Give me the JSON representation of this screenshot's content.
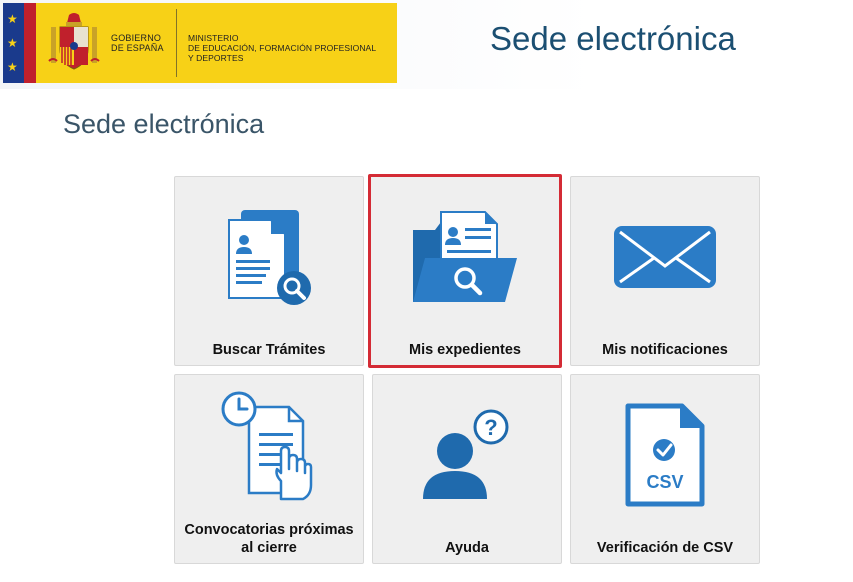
{
  "header": {
    "gov_line1": "GOBIERNO",
    "gov_line2": "DE ESPAÑA",
    "ministry_line1": "MINISTERIO",
    "ministry_line2": "DE EDUCACIÓN, FORMACIÓN PROFESIONAL",
    "ministry_line3": "Y DEPORTES",
    "title": "Sede electrónica"
  },
  "page": {
    "title": "Sede electrónica"
  },
  "tiles": [
    {
      "label": "Buscar Trámites",
      "icon": "document-search-icon"
    },
    {
      "label": "Mis expedientes",
      "icon": "folder-search-icon",
      "selected": true
    },
    {
      "label": "Mis notificaciones",
      "icon": "envelope-icon"
    },
    {
      "label": "Convocatorias próximas al cierre",
      "icon": "clock-document-hand-icon"
    },
    {
      "label": "Ayuda",
      "icon": "user-help-icon"
    },
    {
      "label": "Verificación de CSV",
      "icon": "csv-document-icon",
      "icon_text": "CSV"
    }
  ],
  "colors": {
    "accent": "#2b7cc6",
    "selection": "#d42b35",
    "title": "#1b4f72",
    "banner": "#f7d117"
  }
}
